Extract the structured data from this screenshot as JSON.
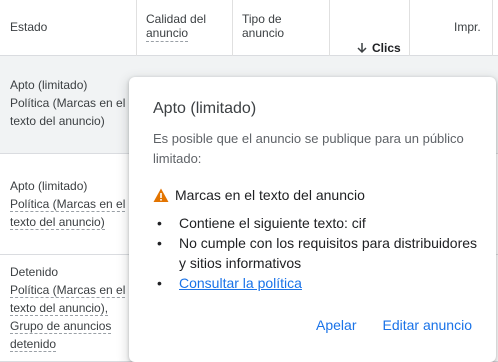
{
  "table": {
    "headers": {
      "estado": "Estado",
      "calidad_line1": "Calidad del",
      "calidad_line2": "anuncio",
      "tipo_line1": "Tipo de",
      "tipo_line2": "anuncio",
      "clics": "Clics",
      "impr": "Impr."
    },
    "rows": [
      {
        "lines": [
          "Apto (limitado)",
          "Política (Marcas en el",
          "texto del anuncio)"
        ]
      },
      {
        "lines": [
          "Apto (limitado)",
          "Política (Marcas en el",
          "texto del anuncio)"
        ]
      },
      {
        "lines": [
          "Detenido",
          "Política (Marcas en el",
          "texto del anuncio),",
          "Grupo de anuncios",
          "detenido"
        ]
      }
    ]
  },
  "popup": {
    "title": "Apto (limitado)",
    "description": "Es posible que el anuncio se publique para un público limitado:",
    "warning_title": "Marcas en el texto del anuncio",
    "warning_icon": "warning-triangle-icon",
    "warning_color": "#e37400",
    "items": [
      "Contiene el siguiente texto: cif",
      "No cumple con los requisitos para distribuidores y sitios informativos"
    ],
    "link": "Consultar la política",
    "appeal_button": "Apelar",
    "edit_button": "Editar anuncio"
  },
  "colors": {
    "accent": "#1a73e8",
    "row_highlight": "#f1f3f4"
  }
}
